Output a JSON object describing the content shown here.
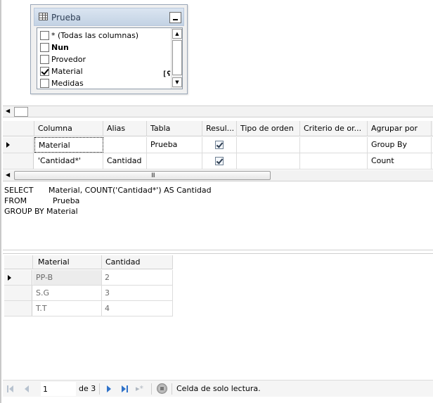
{
  "diagram": {
    "table_title": "Prueba",
    "columns": [
      {
        "label": "* (Todas las columnas)",
        "checked": false,
        "bold": false
      },
      {
        "label": "Nun",
        "checked": false,
        "bold": true
      },
      {
        "label": "Provedor",
        "checked": false,
        "bold": false
      },
      {
        "label": "Material",
        "checked": true,
        "bold": false
      },
      {
        "label": "Medidas",
        "checked": false,
        "bold": false
      }
    ],
    "group_by_glyph": "[ʕ"
  },
  "criteria": {
    "headers": [
      "Columna",
      "Alias",
      "Tabla",
      "Resul...",
      "Tipo de orden",
      "Criterio de or...",
      "Agrupar por"
    ],
    "rows": [
      {
        "columna": "Material",
        "alias": "",
        "tabla": "Prueba",
        "resultado": true,
        "tipo_orden": "",
        "criterio_orden": "",
        "agrupar": "Group By"
      },
      {
        "columna": "'Cantidad*'",
        "alias": "Cantidad",
        "tabla": "",
        "resultado": true,
        "tipo_orden": "",
        "criterio_orden": "",
        "agrupar": "Count"
      }
    ],
    "scroll_grip": "III"
  },
  "sql": {
    "lines": [
      {
        "keyword": "SELECT",
        "body": "Material, COUNT('Cantidad*') AS Cantidad"
      },
      {
        "keyword": "FROM",
        "body": "Prueba"
      },
      {
        "keyword": "GROUP BY",
        "body": "Material"
      }
    ]
  },
  "results": {
    "headers": [
      "Material",
      "Cantidad"
    ],
    "rows": [
      [
        "PP-B",
        "2"
      ],
      [
        "S.G",
        "3"
      ],
      [
        "T.T",
        "4"
      ]
    ]
  },
  "nav": {
    "current_page": "1",
    "page_of": "de 3",
    "status": "Celda de solo lectura."
  }
}
